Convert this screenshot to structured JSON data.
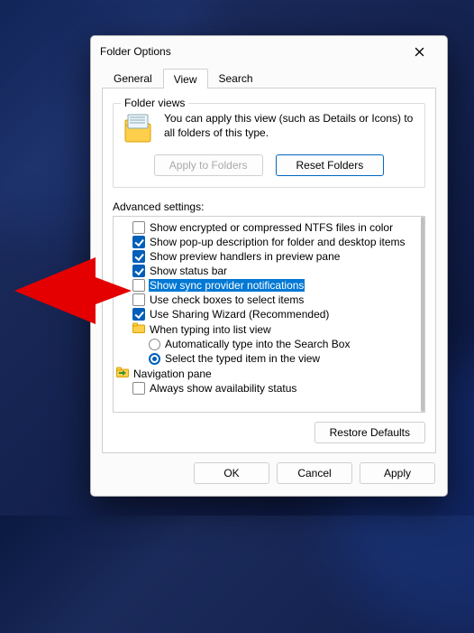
{
  "dialog": {
    "title": "Folder Options",
    "tabs": [
      "General",
      "View",
      "Search"
    ],
    "active_tab": 1,
    "folder_views": {
      "group_label": "Folder views",
      "text": "You can apply this view (such as Details or Icons) to all folders of this type.",
      "apply_btn": "Apply to Folders",
      "reset_btn": "Reset Folders"
    },
    "advanced": {
      "label": "Advanced settings:",
      "items": [
        {
          "type": "check",
          "checked": false,
          "label": "Show encrypted or compressed NTFS files in color",
          "level": 2,
          "selected": false
        },
        {
          "type": "check",
          "checked": true,
          "label": "Show pop-up description for folder and desktop items",
          "level": 2,
          "selected": false
        },
        {
          "type": "check",
          "checked": true,
          "label": "Show preview handlers in preview pane",
          "level": 2,
          "selected": false
        },
        {
          "type": "check",
          "checked": true,
          "label": "Show status bar",
          "level": 2,
          "selected": false
        },
        {
          "type": "check",
          "checked": false,
          "label": "Show sync provider notifications",
          "level": 2,
          "selected": true
        },
        {
          "type": "check",
          "checked": false,
          "label": "Use check boxes to select items",
          "level": 2,
          "selected": false
        },
        {
          "type": "check",
          "checked": true,
          "label": "Use Sharing Wizard (Recommended)",
          "level": 2,
          "selected": false
        },
        {
          "type": "folder",
          "label": "When typing into list view",
          "level": 2
        },
        {
          "type": "radio",
          "checked": false,
          "label": "Automatically type into the Search Box",
          "level": 3
        },
        {
          "type": "radio",
          "checked": true,
          "label": "Select the typed item in the view",
          "level": 3
        },
        {
          "type": "nav",
          "label": "Navigation pane",
          "level": 1
        },
        {
          "type": "check",
          "checked": false,
          "label": "Always show availability status",
          "level": 2,
          "selected": false
        }
      ],
      "restore_btn": "Restore Defaults"
    },
    "buttons": {
      "ok": "OK",
      "cancel": "Cancel",
      "apply": "Apply"
    }
  }
}
